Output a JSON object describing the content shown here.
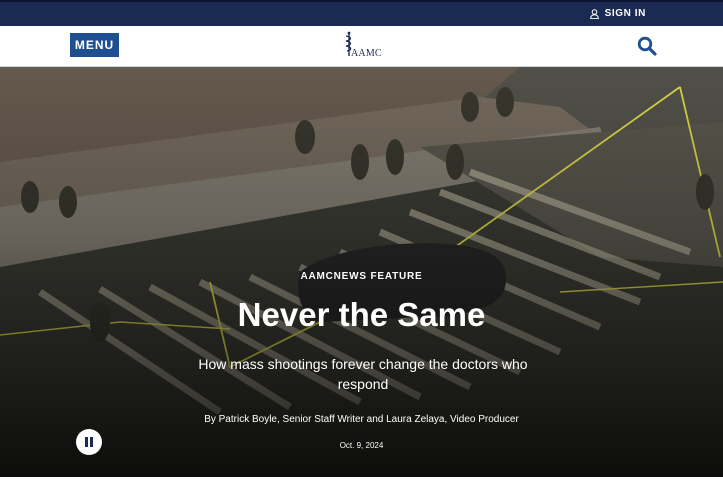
{
  "topbar": {
    "signin_label": "SIGN IN"
  },
  "navbar": {
    "menu_label": "MENU",
    "logo_text": "AAMC"
  },
  "hero": {
    "kicker": "AAMCNEWS FEATURE",
    "title": "Never the Same",
    "subtitle": "How mass shootings forever change the doctors who respond",
    "byline": "By Patrick Boyle, Senior Staff Writer and Laura Zelaya, Video Producer",
    "date": "Oct. 9, 2024"
  },
  "icons": {
    "user": "user-icon",
    "search": "search-icon",
    "pause": "pause-icon",
    "logo": "aamc-logo-icon"
  },
  "colors": {
    "topbar": "#1b2a52",
    "menu_button": "#1d4f91",
    "search_icon": "#1d4f91"
  }
}
